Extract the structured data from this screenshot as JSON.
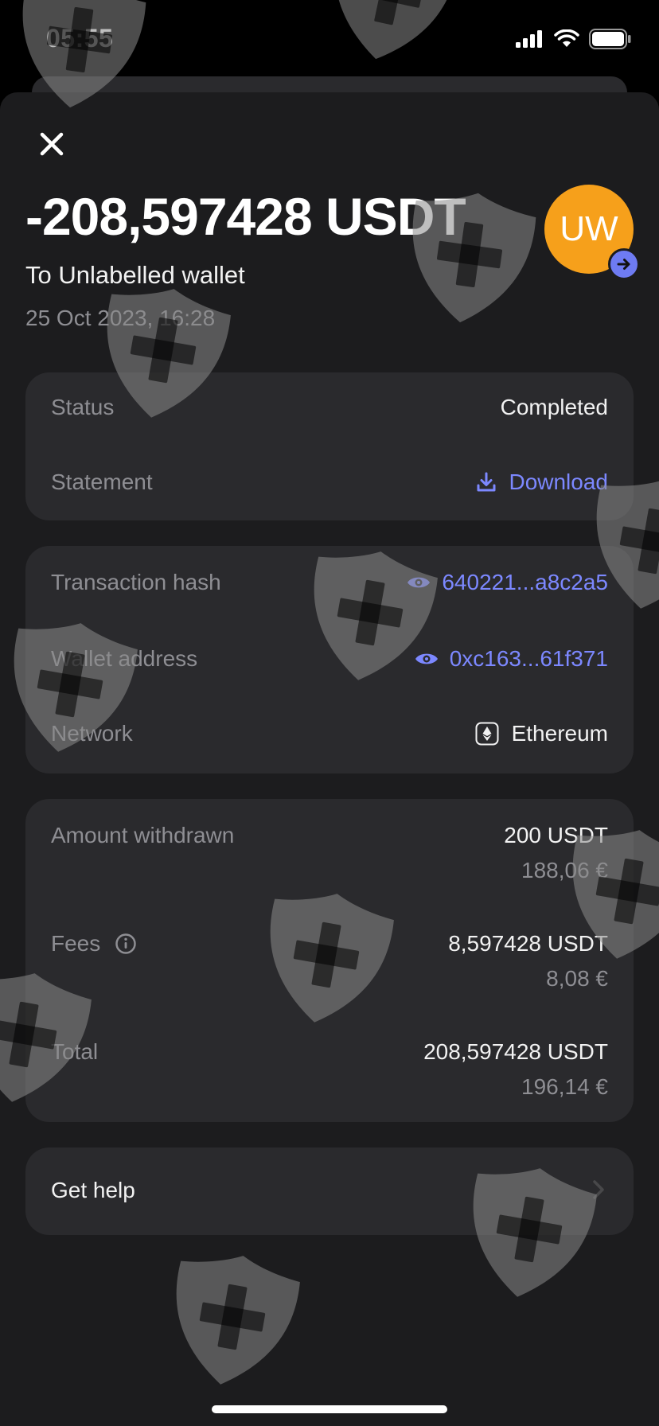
{
  "status_bar": {
    "time": "05:55"
  },
  "header": {
    "amount": "-208,597428 USDT",
    "recipient": "To Unlabelled wallet",
    "date": "25 Oct 2023, 16:28",
    "avatar_initials": "UW"
  },
  "card1": {
    "status_label": "Status",
    "status_value": "Completed",
    "statement_label": "Statement",
    "download_label": "Download"
  },
  "card2": {
    "hash_label": "Transaction hash",
    "hash_value": "640221...a8c2a5",
    "wallet_label": "Wallet address",
    "wallet_value": "0xc163...61f371",
    "network_label": "Network",
    "network_value": "Ethereum"
  },
  "card3": {
    "withdrawn_label": "Amount withdrawn",
    "withdrawn_value": "200 USDT",
    "withdrawn_fiat": "188,06 €",
    "fees_label": "Fees",
    "fees_value": "8,597428 USDT",
    "fees_fiat": "8,08 €",
    "total_label": "Total",
    "total_value": "208,597428 USDT",
    "total_fiat": "196,14 €"
  },
  "help": {
    "label": "Get help"
  },
  "colors": {
    "accent": "#7c88ff",
    "avatar_bg": "#f6a01b",
    "sheet_bg": "#1c1c1e",
    "card_bg": "#2a2a2d"
  }
}
